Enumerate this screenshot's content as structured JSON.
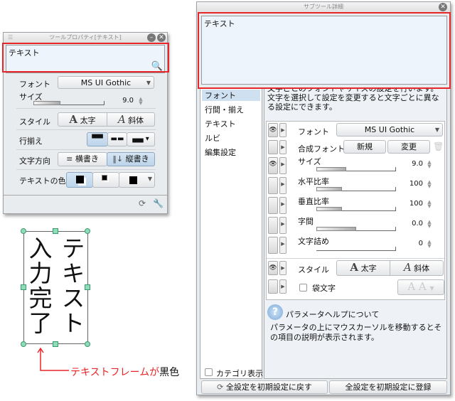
{
  "tool_property": {
    "title": "ツールプロパティ[テキスト]",
    "text_value": "テキスト",
    "rows": {
      "font_label": "フォント",
      "font_value": "MS UI Gothic",
      "size_label": "サイズ",
      "size_value": "9.0",
      "size_fraction": 0.38,
      "style_label": "スタイル",
      "bold_label": "太字",
      "italic_label": "斜体",
      "align_label": "行揃え",
      "direction_label": "文字方向",
      "horizontal_label": "横書き",
      "vertical_label": "縦書き",
      "color_label": "テキストの色"
    }
  },
  "canvas": {
    "text_col1": "テキスト",
    "text_col2": "入力完了",
    "annotation_red": "テキストフレームが",
    "annotation_black": "黒色",
    "annotation_color": "#e8262a"
  },
  "sub_tool_detail": {
    "title": "サブツール詳細",
    "text_value": "テキスト",
    "categories": [
      "フォント",
      "行間・揃え",
      "テキスト",
      "ルビ",
      "編集設定"
    ],
    "selected_category": "フォント",
    "description_line1": "文字ごとのフォントやサイズの設定を行います。",
    "description_line2": "文字を選択して設定を変更すると文字ごとに異な",
    "description_line3": "る設定にできます。",
    "font_label": "フォント",
    "font_value": "MS UI Gothic",
    "composite_font_label": "合成フォント",
    "new_label": "新規",
    "change_label": "変更",
    "params": [
      {
        "label": "サイズ",
        "value": "9.0",
        "fraction": 0.38
      },
      {
        "label": "水平比率",
        "value": "100",
        "fraction": 0.32
      },
      {
        "label": "垂直比率",
        "value": "100",
        "fraction": 0.32
      },
      {
        "label": "字間",
        "value": "0.0",
        "fraction": 0.5
      },
      {
        "label": "文字詰め",
        "value": "0",
        "fraction": 0
      }
    ],
    "style_label": "スタイル",
    "bold_label": "太字",
    "italic_label": "斜体",
    "outline_label": "袋文字",
    "help_title": "パラメータヘルプについて",
    "help_text": "パラメータの上にマウスカーソルを移動するとその項目の説明が表示されます。",
    "category_display_label": "カテゴリ表示",
    "reset_label": "全設定を初期設定に戻す",
    "register_label": "全設定を初期設定に登録"
  }
}
